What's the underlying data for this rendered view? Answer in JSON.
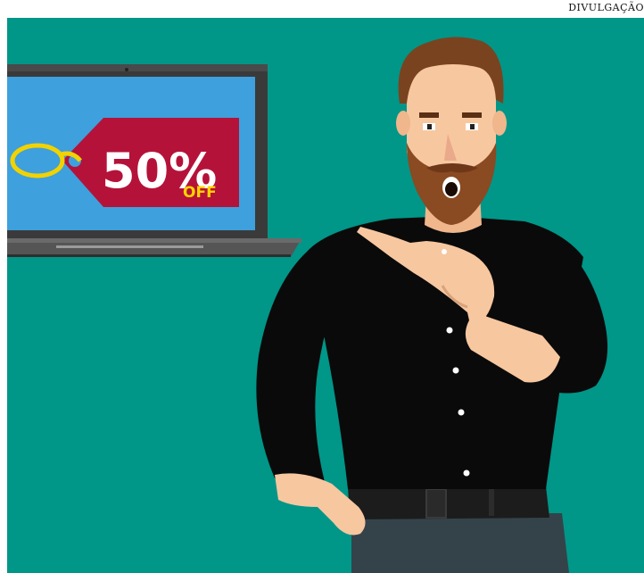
{
  "credit": "DIVULGAÇÃO",
  "promo": {
    "percent": "50%",
    "off": "OFF"
  },
  "colors": {
    "background": "#009688",
    "screen": "#3ea0dc",
    "tag": "#b5123a",
    "tag_text": "#ffffff",
    "off_text": "#ffd400",
    "ring": "#f2d200",
    "shirt": "#0a0a0a",
    "skin": "#f7c7a0",
    "hair": "#7a4320"
  }
}
